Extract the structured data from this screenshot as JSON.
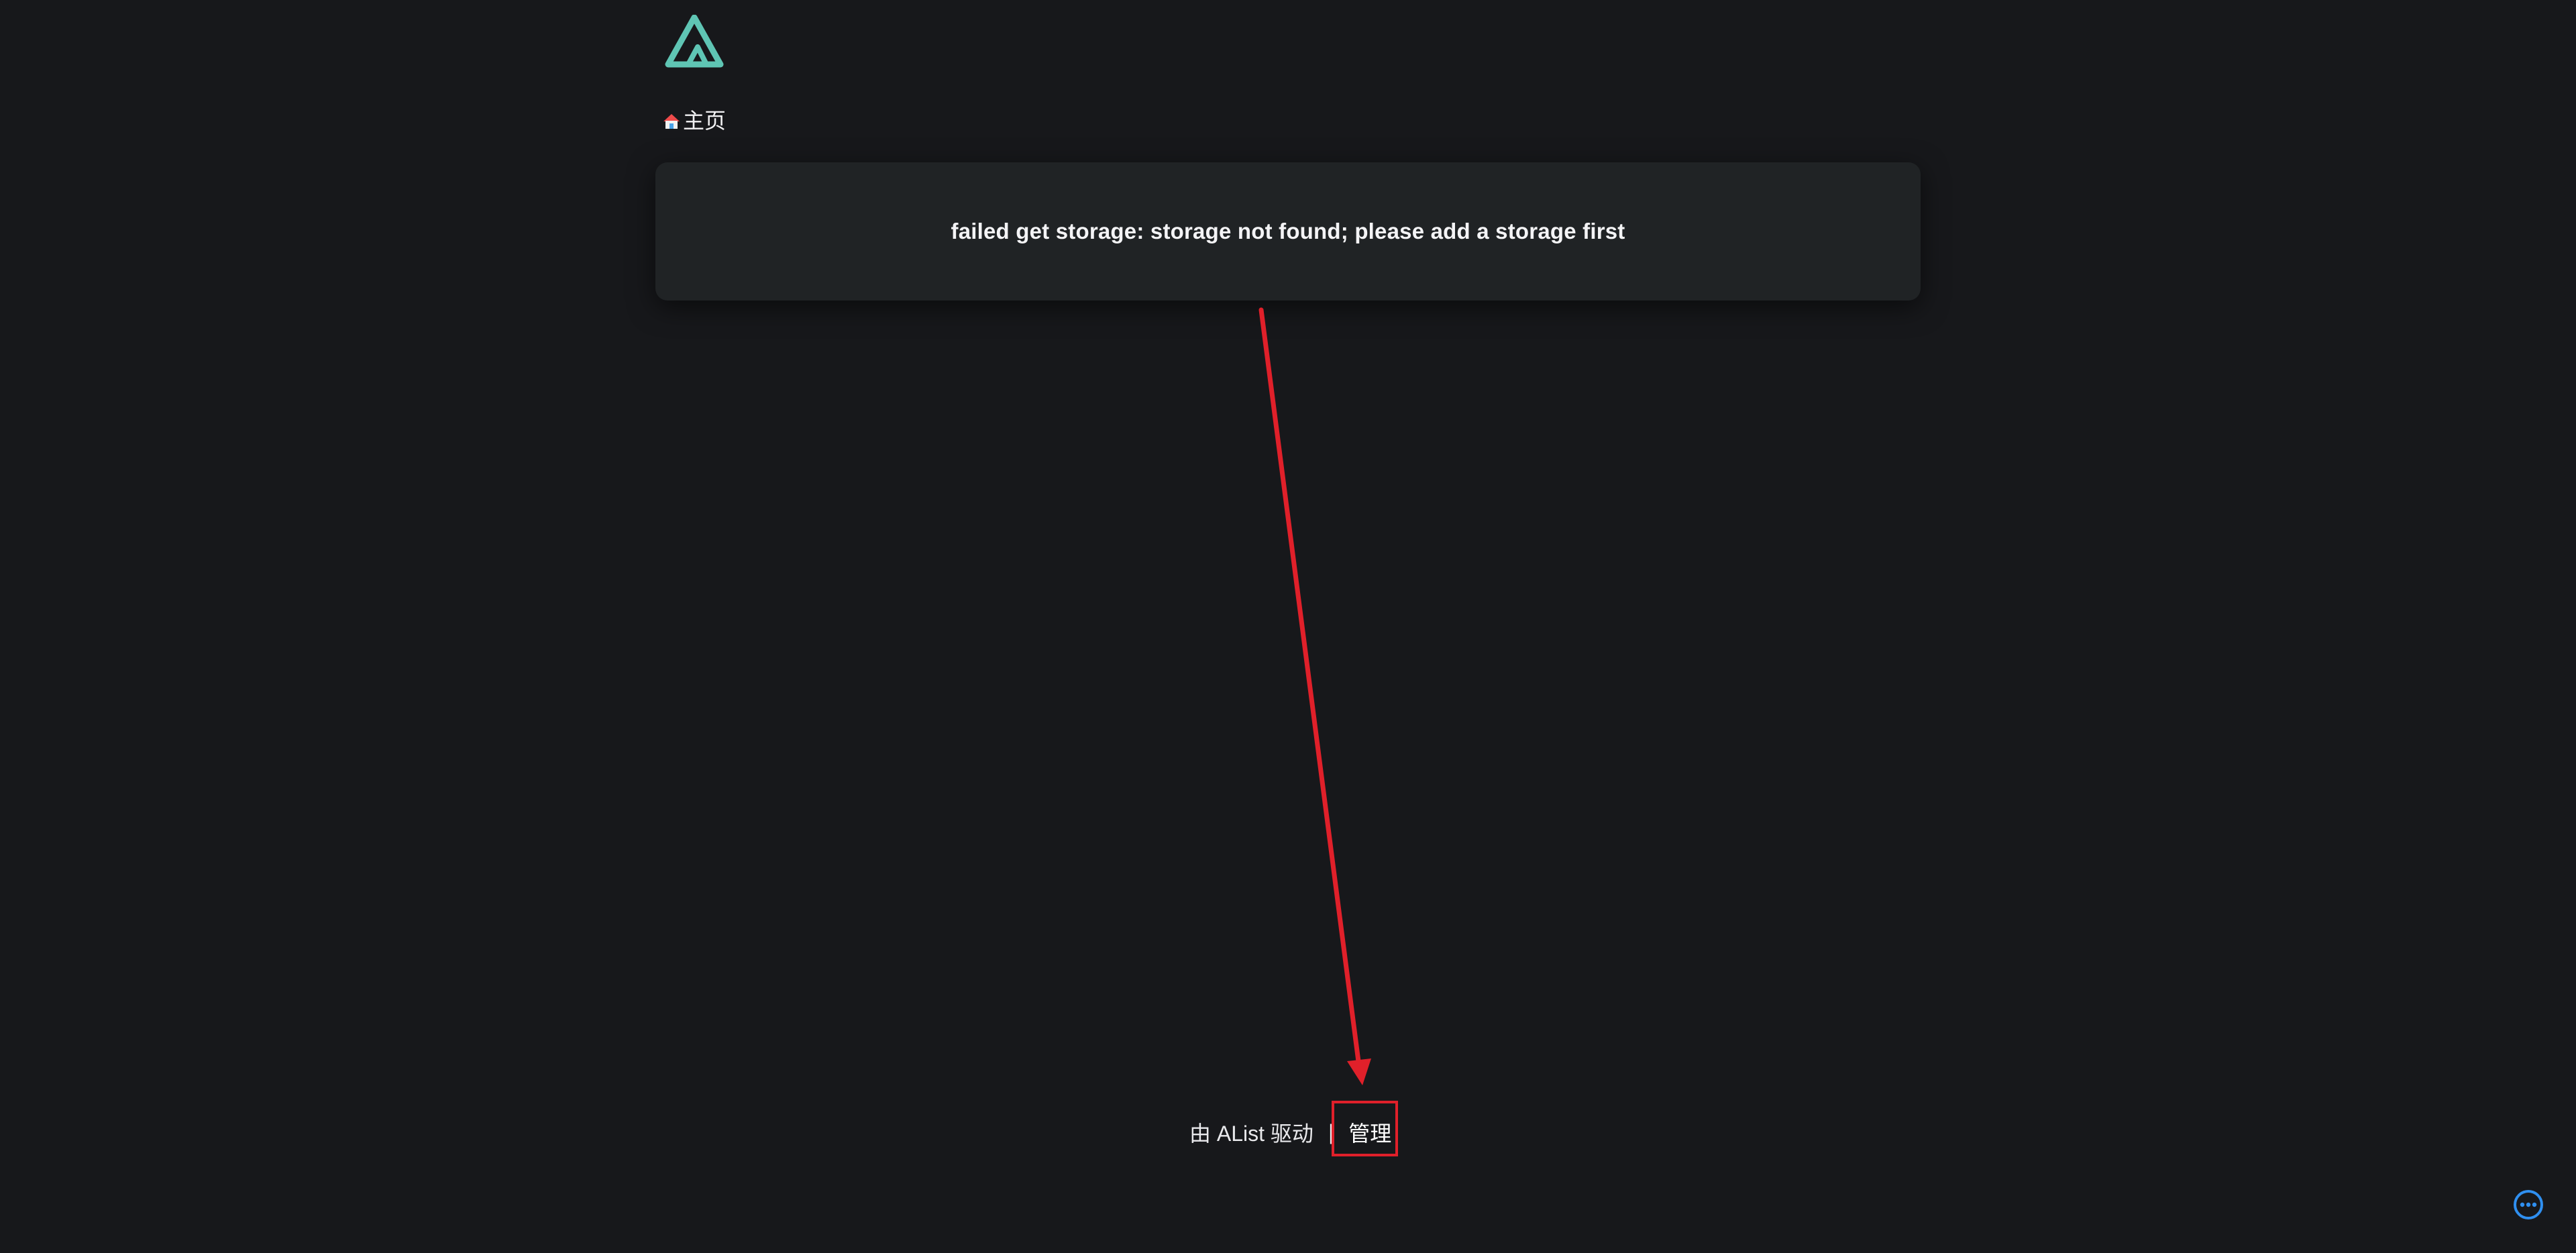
{
  "header": {
    "logo_icon": "alist-logo-icon",
    "logo_color": "#5fc5b4"
  },
  "breadcrumb": {
    "home_icon": "home-icon",
    "home_label": "主页"
  },
  "message_card": {
    "text": "failed get storage: storage not found; please add a storage first"
  },
  "footer": {
    "powered_by": "由 AList 驱动",
    "separator": "|",
    "admin_label": "管理"
  },
  "annotation": {
    "color": "#e0202a",
    "arrow_icon": "red-arrow",
    "highlight_target": "admin-link"
  },
  "floating": {
    "more_icon": "more-circle-icon",
    "color": "#2f8ff0"
  }
}
